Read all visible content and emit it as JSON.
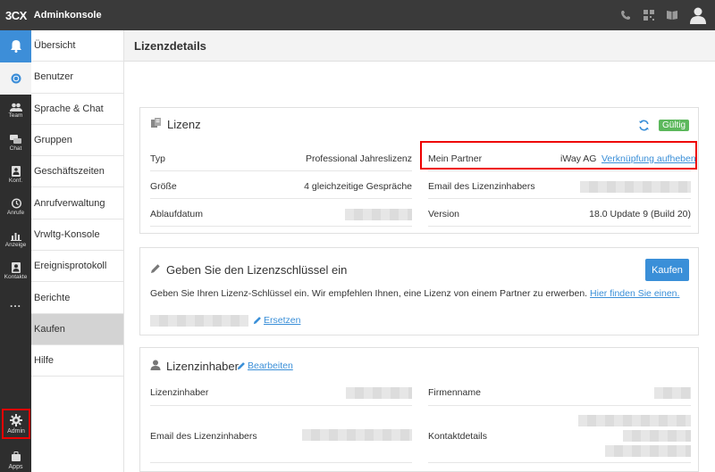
{
  "topbar": {
    "logo": "3CX",
    "title": "Adminkonsole"
  },
  "rail": {
    "items": [
      {
        "label": "",
        "icon": "bell-icon"
      },
      {
        "label": "",
        "icon": "chrome-icon"
      },
      {
        "label": "Team",
        "icon": "team-icon"
      },
      {
        "label": "Chat",
        "icon": "chat-icon"
      },
      {
        "label": "Konf.",
        "icon": "conference-icon"
      },
      {
        "label": "Anrufe",
        "icon": "history-icon"
      },
      {
        "label": "Anzeige",
        "icon": "chart-icon"
      },
      {
        "label": "Kontakte",
        "icon": "contacts-icon"
      },
      {
        "label": "...",
        "icon": "more-icon"
      }
    ],
    "admin": "Admin",
    "apps": "Apps"
  },
  "subnav": {
    "items": [
      "Übersicht",
      "Benutzer",
      "Sprache & Chat",
      "Gruppen",
      "Geschäftszeiten",
      "Anrufverwaltung",
      "Vrwltg-Konsole",
      "Ereignisprotokoll",
      "Berichte",
      "Kaufen",
      "Hilfe"
    ],
    "selected_index": 9
  },
  "page": {
    "title": "Lizenzdetails"
  },
  "license": {
    "title": "Lizenz",
    "status": "Gültig",
    "status_color": "#5cb85c",
    "type_label": "Typ",
    "type_value": "Professional Jahreslizenz",
    "size_label": "Größe",
    "size_value": "4 gleichzeitige Gespräche",
    "expiry_label": "Ablaufdatum",
    "partner_label": "Mein Partner",
    "partner_value": "iWay AG",
    "unlink_link": "Verknüpfung aufheben",
    "owner_email_label": "Email des Lizenzinhabers",
    "version_label": "Version",
    "version_value": "18.0 Update 9 (Build 20)"
  },
  "key": {
    "title": "Geben Sie den Lizenzschlüssel ein",
    "buy_button": "Kaufen",
    "description": "Geben Sie Ihren Lizenz-Schlüssel ein. Wir empfehlen Ihnen, eine Lizenz von einem Partner zu erwerben.",
    "find_link": "Hier finden Sie einen.",
    "replace_link": "Ersetzen"
  },
  "owner": {
    "title": "Lizenzinhaber",
    "edit_link": "Bearbeiten",
    "owner_label": "Lizenzinhaber",
    "company_label": "Firmenname",
    "email_label": "Email des Lizenzinhabers",
    "contact_label": "Kontaktdetails"
  },
  "colors": {
    "accent": "#3a8fd8",
    "highlight": "#ee0000",
    "topbar": "#3a3a3a"
  }
}
